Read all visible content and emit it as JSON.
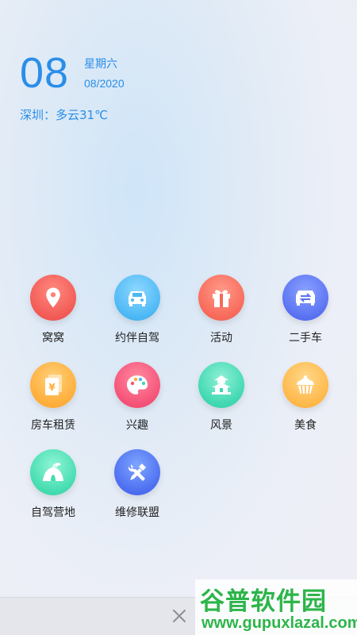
{
  "header": {
    "day": "08",
    "weekday": "星期六",
    "date": "08/2020",
    "weather": "深圳：多云31℃"
  },
  "menu": [
    {
      "label": "窝窝",
      "icon": "location-pin-icon",
      "color": "#f25a55"
    },
    {
      "label": "约伴自驾",
      "icon": "car-icon",
      "color": "#4cb8f5"
    },
    {
      "label": "活动",
      "icon": "gift-icon",
      "color": "#f86a5a"
    },
    {
      "label": "二手车",
      "icon": "exchange-car-icon",
      "color": "#5a72f2"
    },
    {
      "label": "房车租赁",
      "icon": "rental-document-icon",
      "color": "#ffae3a"
    },
    {
      "label": "兴趣",
      "icon": "palette-icon",
      "color": "#f55278"
    },
    {
      "label": "风景",
      "icon": "pagoda-icon",
      "color": "#3fd8b0"
    },
    {
      "label": "美食",
      "icon": "cake-icon",
      "color": "#ffb84a"
    },
    {
      "label": "自驾营地",
      "icon": "tent-icon",
      "color": "#45dcb0"
    },
    {
      "label": "维修联盟",
      "icon": "repair-tools-icon",
      "color": "#4d6ef0"
    }
  ],
  "bottom": {
    "close_icon": "close-icon"
  },
  "watermark": {
    "title": "谷普软件园",
    "url": "www.gupuxlazal.com"
  }
}
